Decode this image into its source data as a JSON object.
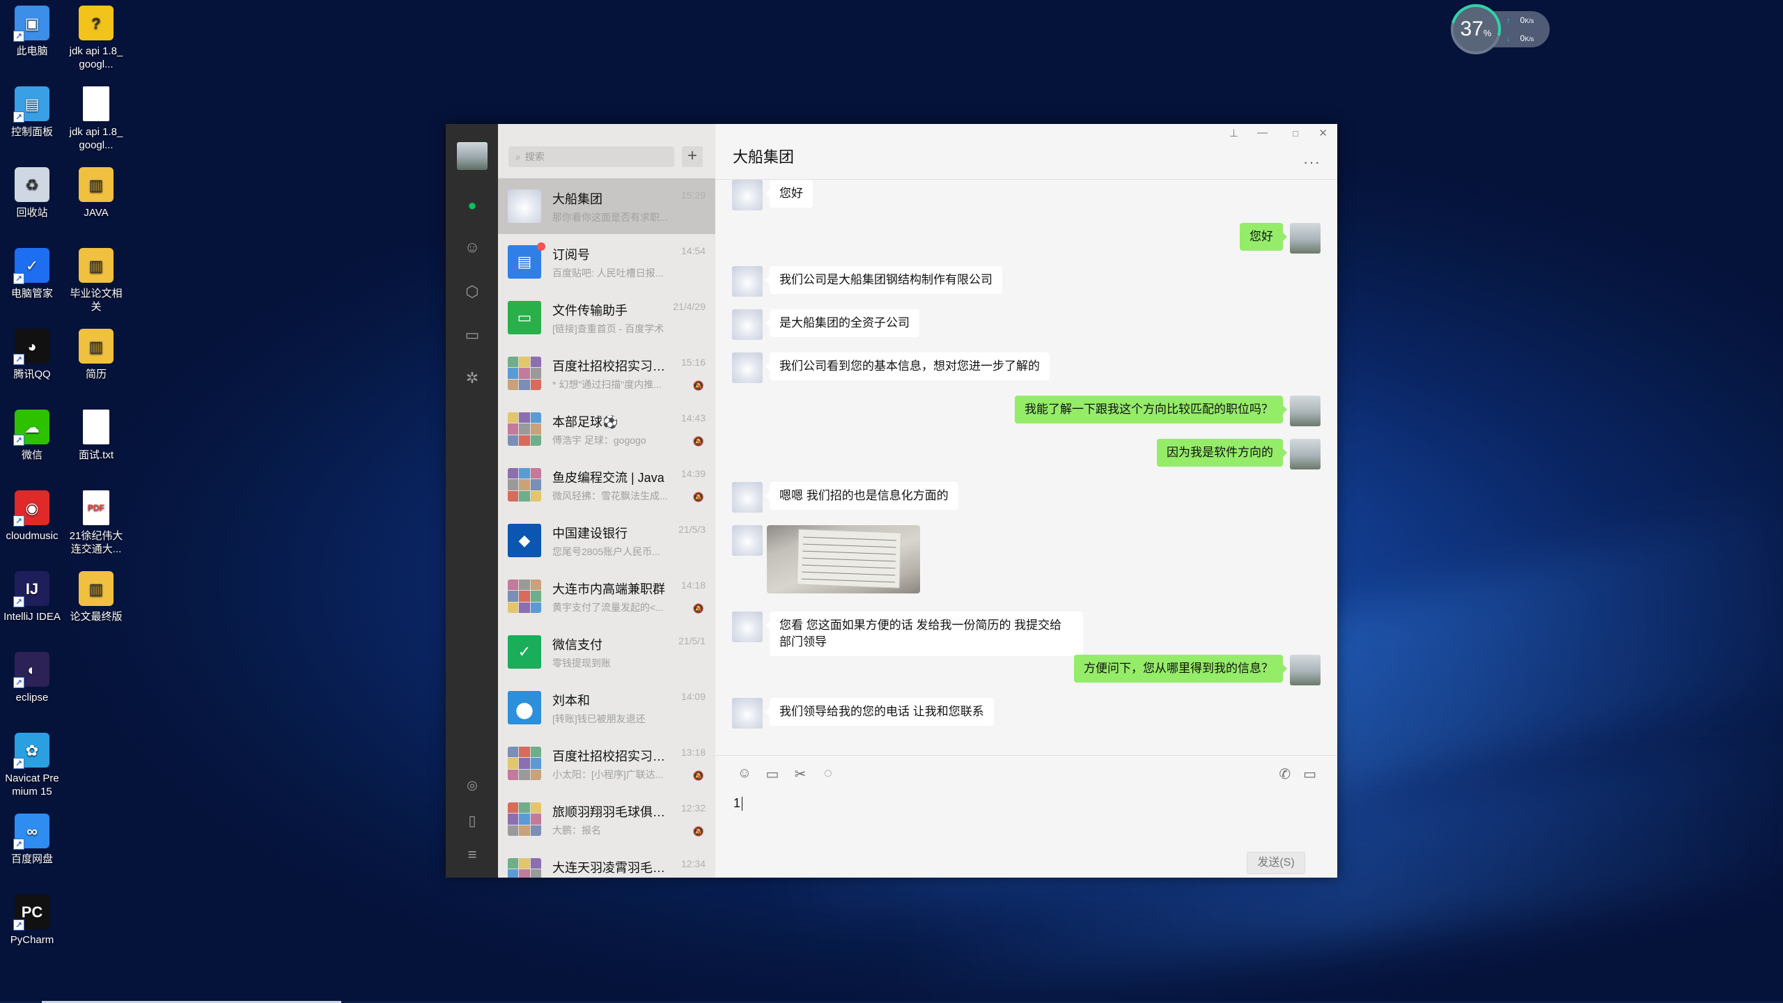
{
  "desktop": {
    "icons": [
      {
        "label": "此电脑",
        "icon": "computer-icon",
        "color": "#3c8ee8"
      },
      {
        "label": "jdk api 1.8_googl...",
        "icon": "chm-help-icon",
        "color": "#f2c31a"
      },
      {
        "label": "控制面板",
        "icon": "control-panel-icon",
        "color": "#3aa0e6"
      },
      {
        "label": "jdk api 1.8_googl...",
        "icon": "file-icon",
        "color": "#ffffff"
      },
      {
        "label": "回收站",
        "icon": "recycle-bin-icon",
        "color": "#cfd8e2"
      },
      {
        "label": "JAVA",
        "icon": "folder-zip-icon",
        "color": "#f0c040"
      },
      {
        "label": "电脑管家",
        "icon": "pc-manager-icon",
        "color": "#1d6ef0"
      },
      {
        "label": "毕业论文相关",
        "icon": "folder-zip-icon",
        "color": "#f0c040"
      },
      {
        "label": "腾讯QQ",
        "icon": "qq-icon",
        "color": "#111111"
      },
      {
        "label": "简历",
        "icon": "folder-zip-icon",
        "color": "#f0c040"
      },
      {
        "label": "微信",
        "icon": "wechat-icon",
        "color": "#2dc100"
      },
      {
        "label": "面试.txt",
        "icon": "txt-file-icon",
        "color": "#ffffff"
      },
      {
        "label": "cloudmusic",
        "icon": "netease-music-icon",
        "color": "#e02a2a"
      },
      {
        "label": "21徐纪伟大连交通大...",
        "icon": "pdf-icon",
        "color": "#e0403a"
      },
      {
        "label": "IntelliJ IDEA",
        "icon": "intellij-icon",
        "color": "#1e1e5a"
      },
      {
        "label": "论文最终版",
        "icon": "folder-zip-icon",
        "color": "#f0c040"
      },
      {
        "label": "eclipse",
        "icon": "eclipse-icon",
        "color": "#2c2255"
      },
      {
        "label": "Navicat Premium 15",
        "icon": "navicat-icon",
        "color": "#2aa0e0"
      },
      {
        "label": "百度网盘",
        "icon": "baidu-netdisk-icon",
        "color": "#2f8cf0"
      },
      {
        "label": "PyCharm",
        "icon": "pycharm-icon",
        "color": "#111111"
      }
    ]
  },
  "net_widget": {
    "percent": "37",
    "percent_unit": "%",
    "up": "0",
    "down": "0",
    "unit": "K/s"
  },
  "wechat": {
    "search_placeholder": "搜索",
    "add_label": "+",
    "nav_icons": [
      "chat-icon",
      "contacts-icon",
      "favorites-icon",
      "files-icon",
      "moments-icon",
      "mini-program-icon",
      "phone-icon",
      "menu-icon"
    ],
    "chats": [
      {
        "name": "大船集团",
        "time": "15:29",
        "preview": "那你看你这面是否有求职...",
        "muted": false,
        "selected": true,
        "avatar": "other"
      },
      {
        "name": "订阅号",
        "time": "14:54",
        "preview": "百度贴吧: 人民吐槽日报...",
        "muted": false,
        "unread": true,
        "avatar": "subscription",
        "color": "#2f7fe6"
      },
      {
        "name": "文件传输助手",
        "time": "21/4/29",
        "preview": "[链接]查重首页 - 百度学术",
        "muted": false,
        "avatar": "file-transfer",
        "color": "#2ab04a"
      },
      {
        "name": "百度社招校招实习内...",
        "time": "15:16",
        "preview": "* 幻想\"通过扫描\"度内推...",
        "muted": true,
        "avatar": "group"
      },
      {
        "name": "本部足球⚽",
        "time": "14:43",
        "preview": "傅浩宇 足球：gogogo",
        "muted": true,
        "avatar": "group"
      },
      {
        "name": "鱼皮编程交流 | Java",
        "time": "14:39",
        "preview": "微风轻拂：雪花飘法生成...",
        "muted": true,
        "avatar": "group"
      },
      {
        "name": "中国建设银行",
        "time": "21/5/3",
        "preview": "您尾号2805账户人民币...",
        "muted": false,
        "avatar": "ccb",
        "color": "#0a56b0"
      },
      {
        "name": "大连市内高端兼职群",
        "time": "14:18",
        "preview": "黄宇支付了流量发起的<...",
        "muted": true,
        "avatar": "group"
      },
      {
        "name": "微信支付",
        "time": "21/5/1",
        "preview": "零钱提现到账",
        "muted": false,
        "avatar": "wxpay",
        "color": "#1aad5a"
      },
      {
        "name": "刘本和",
        "time": "14:09",
        "preview": "[转账]钱已被朋友退还",
        "muted": false,
        "avatar": "doraemon"
      },
      {
        "name": "百度社招校招实习内...",
        "time": "13:18",
        "preview": "小太阳：[小程序]广联达...",
        "muted": true,
        "avatar": "group"
      },
      {
        "name": "旅顺羽翔羽毛球俱乐...",
        "time": "12:32",
        "preview": "大鹏：报名",
        "muted": true,
        "avatar": "group"
      },
      {
        "name": "大连天羽凌霄羽毛球...",
        "time": "12:34",
        "preview": "",
        "muted": false,
        "avatar": "group"
      }
    ],
    "current_chat": {
      "title": "大船集团",
      "messages": [
        {
          "side": "left",
          "text": "您好"
        },
        {
          "side": "right",
          "text": "您好"
        },
        {
          "side": "left",
          "text": "我们公司是大船集团钢结构制作有限公司"
        },
        {
          "side": "left",
          "text": "是大船集团的全资子公司"
        },
        {
          "side": "left",
          "text": "我们公司看到您的基本信息，想对您进一步了解的"
        },
        {
          "side": "right",
          "text": "我能了解一下跟我这个方向比较匹配的职位吗？"
        },
        {
          "side": "right",
          "text": "因为我是软件方向的"
        },
        {
          "side": "left",
          "text": "嗯嗯 我们招的也是信息化方面的"
        },
        {
          "side": "left",
          "type": "image"
        },
        {
          "side": "left",
          "text": "您看 您这面如果方便的话 发给我一份简历的 我提交给部门领导"
        },
        {
          "side": "right",
          "text": "方便问下，您从哪里得到我的信息？"
        },
        {
          "side": "left",
          "text": "我们领导给我的您的电话 让我和您联系"
        }
      ],
      "input_value": "1",
      "send_label": "发送(S)",
      "tool_icons": [
        "emoji-icon",
        "folder-icon",
        "scissors-icon",
        "chat-bubble-icon"
      ],
      "call_icons": [
        "voice-call-icon",
        "video-call-icon"
      ]
    }
  }
}
